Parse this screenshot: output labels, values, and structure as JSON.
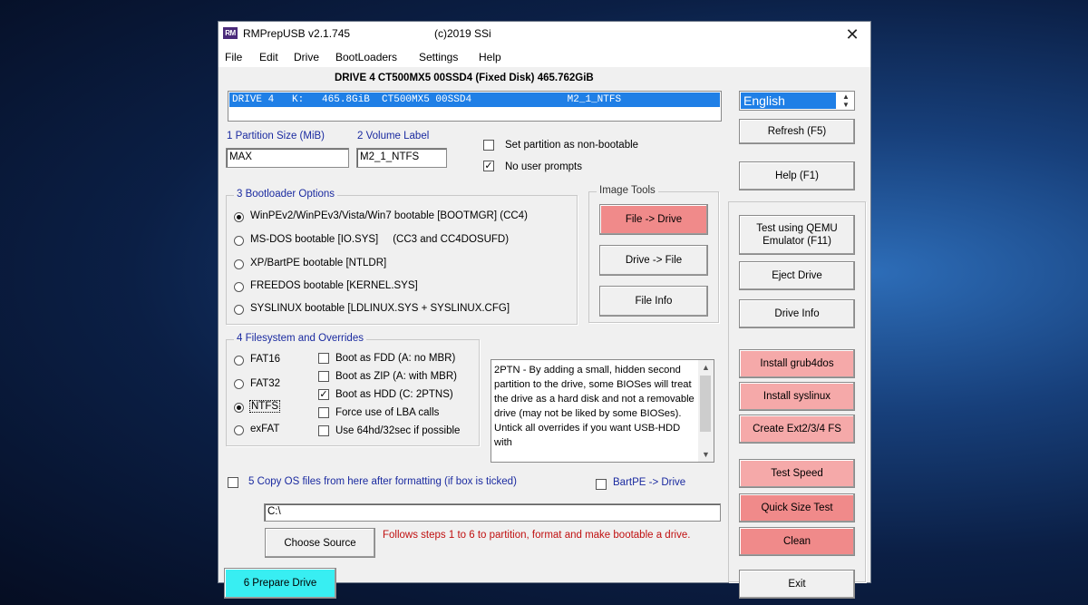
{
  "window": {
    "title": "RMPrepUSB v2.1.745",
    "copyright": "(c)2019 SSi",
    "app_icon_text": "RM",
    "close_glyph": "✕"
  },
  "menu": [
    "File",
    "Edit",
    "Drive",
    "BootLoaders",
    "Settings",
    "Help"
  ],
  "drive_header": "DRIVE 4 CT500MX5 00SSD4  (Fixed Disk) 465.762GiB",
  "drive_list": {
    "selected_row": "DRIVE 4   K:   465.8GiB  CT500MX5 00SSD4                M2_1_NTFS"
  },
  "language": {
    "value": "English",
    "spin_up": "▲",
    "spin_down": "▼"
  },
  "partition": {
    "size_label": "1 Partition Size (MiB)",
    "size_value": "MAX",
    "volume_label": "2 Volume Label",
    "volume_value": "M2_1_NTFS"
  },
  "options": {
    "non_bootable": {
      "label": "Set partition as non-bootable",
      "checked": false
    },
    "no_prompts": {
      "label": "No user prompts",
      "checked": true,
      "mark": "✓"
    }
  },
  "bootloader": {
    "title": "3 Bootloader Options",
    "items": [
      {
        "label": "WinPEv2/WinPEv3/Vista/Win7 bootable [BOOTMGR] (CC4)",
        "selected": true
      },
      {
        "label": "MS-DOS bootable [IO.SYS]     (CC3 and CC4DOSUFD)",
        "selected": false
      },
      {
        "label": "XP/BartPE bootable [NTLDR]",
        "selected": false
      },
      {
        "label": "FREEDOS bootable [KERNEL.SYS]",
        "selected": false
      },
      {
        "label": "SYSLINUX bootable [LDLINUX.SYS + SYSLINUX.CFG]",
        "selected": false
      }
    ]
  },
  "image_tools": {
    "title": "Image Tools",
    "file_to_drive": "File -> Drive",
    "drive_to_file": "Drive -> File",
    "file_info": "File Info"
  },
  "filesystem": {
    "title": "4 Filesystem and Overrides",
    "types": [
      {
        "label": "FAT16",
        "selected": false
      },
      {
        "label": "FAT32",
        "selected": false
      },
      {
        "label": "NTFS",
        "selected": true
      },
      {
        "label": "exFAT",
        "selected": false
      }
    ],
    "overrides": [
      {
        "label": "Boot as FDD (A: no MBR)",
        "checked": false
      },
      {
        "label": "Boot as ZIP (A: with MBR)",
        "checked": false
      },
      {
        "label": "Boot as HDD (C: 2PTNS)",
        "checked": true
      },
      {
        "label": "Force use of LBA calls",
        "checked": false
      },
      {
        "label": "Use 64hd/32sec if possible",
        "checked": false
      }
    ],
    "check_mark": "✓"
  },
  "info_text": "2PTN - By adding a small, hidden second partition to the drive, some BIOSes will treat the drive as a hard disk and not a removable drive (may not be liked by some BIOSes). Untick all overrides if you want USB-HDD with",
  "copy_os": {
    "label": "5 Copy OS files from here after formatting (if box is ticked)",
    "checked": false
  },
  "bartpe": {
    "label": "BartPE -> Drive",
    "checked": false
  },
  "source_path": "C:\\",
  "choose_source": "Choose Source",
  "steps_hint": "Follows steps 1 to 6 to partition, format and make bootable a drive.",
  "prepare_drive": "6 Prepare Drive",
  "right_buttons": {
    "refresh": "Refresh (F5)",
    "help": "Help (F1)",
    "qemu_line1": "Test using QEMU",
    "qemu_line2": "Emulator (F11)",
    "eject": "Eject Drive",
    "drive_info": "Drive Info",
    "grub4dos": "Install grub4dos",
    "syslinux": "Install syslinux",
    "ext": "Create Ext2/3/4 FS",
    "speed": "Test Speed",
    "quick_size": "Quick Size Test",
    "clean": "Clean",
    "exit": "Exit"
  },
  "colors": {
    "selection_blue": "#1f7fe6",
    "label_blue": "#1a2aa0",
    "pink_button": "#f5a9a9",
    "red_button": "#f08a8a",
    "cyan_button": "#38eef2",
    "hint_red": "#c01010"
  }
}
